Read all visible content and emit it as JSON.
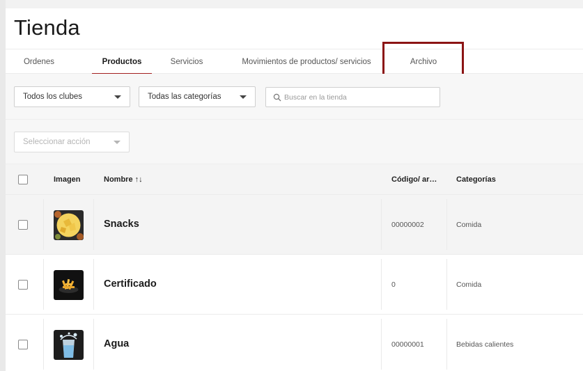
{
  "page": {
    "title": "Tienda"
  },
  "tabs": [
    {
      "label": "Ordenes"
    },
    {
      "label": "Productos"
    },
    {
      "label": "Servicios"
    },
    {
      "label": "Movimientos de productos/ servicios"
    },
    {
      "label": "Archivo"
    }
  ],
  "filters": {
    "club": "Todos los clubes",
    "category": "Todas las categorías",
    "search_placeholder": "Buscar en la tienda"
  },
  "bulk_action": {
    "placeholder": "Seleccionar acción"
  },
  "table": {
    "columns": {
      "image": "Imagen",
      "name": "Nombre ↑↓",
      "code": "Código/ ar…",
      "category": "Categorías"
    },
    "rows": [
      {
        "name": "Snacks",
        "code": "00000002",
        "category": "Comida",
        "image_icon": "snack-plate-icon"
      },
      {
        "name": "Certificado",
        "code": "0",
        "category": "Comida",
        "image_icon": "fries-icon"
      },
      {
        "name": "Agua",
        "code": "00000001",
        "category": "Bebidas calientes",
        "image_icon": "water-glass-icon"
      }
    ]
  },
  "colors": {
    "accent": "#a32020",
    "highlight_box": "#8b1414"
  }
}
